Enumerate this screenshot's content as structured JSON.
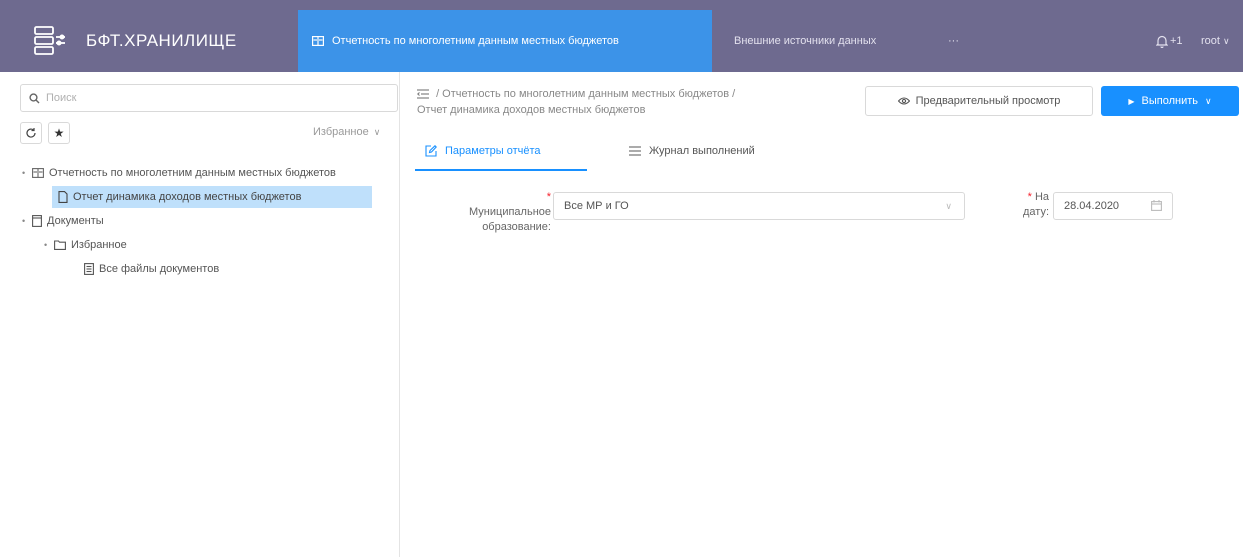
{
  "header": {
    "brand_title": "БФТ.ХРАНИЛИЩЕ",
    "nav_active_label": "Отчетность по многолетним данным местных бюджетов",
    "nav_external_label": "Внешние источники данных",
    "nav_more_label": "···",
    "notification_count": "+1",
    "user_label": "root",
    "colors": {
      "topbar": "#6e6a8f",
      "active_tab": "#3c93e8"
    }
  },
  "sidebar": {
    "search_placeholder": "Поиск",
    "favorites_label": "Избранное",
    "tree": {
      "reporting_folder": "Отчетность по многолетним данным местных бюджетов",
      "report_item": "Отчет динамика доходов местных бюджетов",
      "documents_folder": "Документы",
      "favorites_folder": "Избранное",
      "all_files": "Все файлы документов"
    }
  },
  "main": {
    "breadcrumb_line1": "/ Отчетность по многолетним данным местных бюджетов /",
    "breadcrumb_line2": "Отчет динамика доходов местных бюджетов",
    "preview_label": "Предварительный просмотр",
    "run_label": "Выполнить",
    "tabs": {
      "params": "Параметры отчёта",
      "journal": "Журнал выполнений"
    },
    "fields": {
      "municipal_required": "*",
      "municipal_label_1": "Муниципальное",
      "municipal_label_2": "образование:",
      "municipal_value": "Все МР и ГО",
      "date_required": "*",
      "date_label_1": "На",
      "date_label_2": "дату:",
      "date_value": "28.04.2020"
    },
    "colors": {
      "accent": "#1890ff",
      "selected_row": "#bfe0fb"
    }
  }
}
